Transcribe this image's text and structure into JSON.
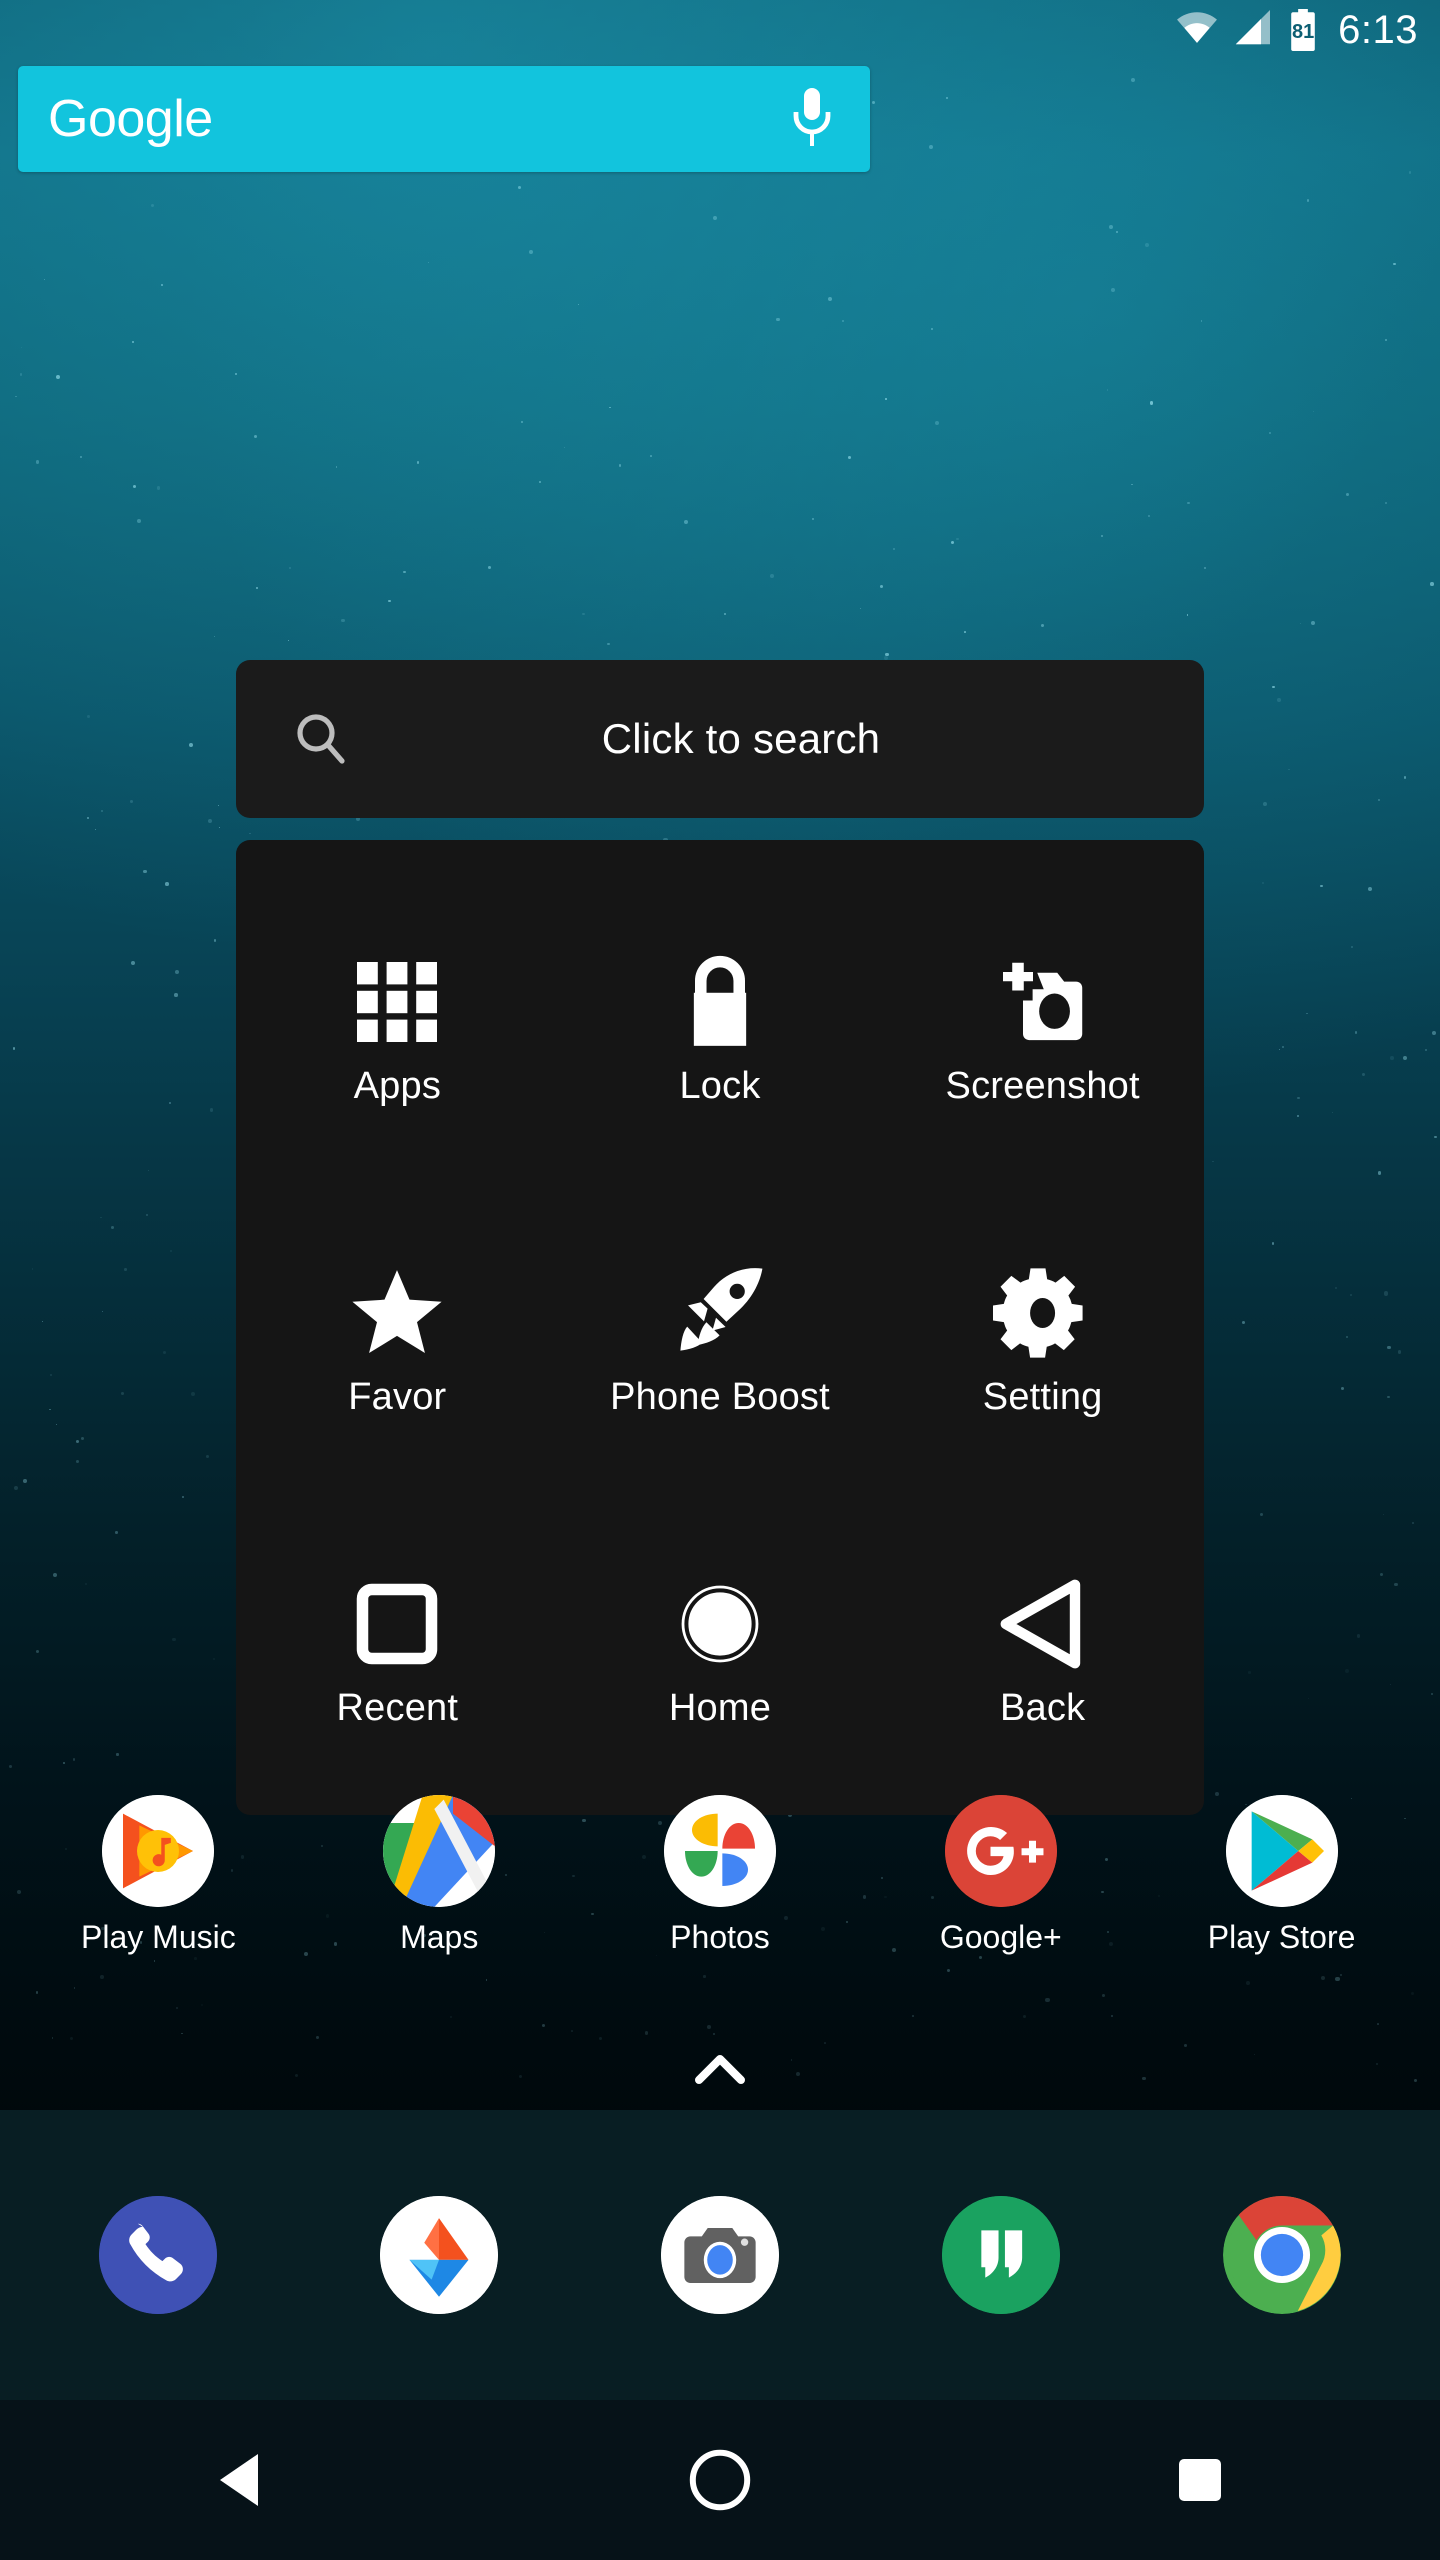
{
  "status_bar": {
    "wifi_icon": "wifi-icon",
    "signal_icon": "cellular-signal-icon",
    "battery_icon": "battery-icon",
    "battery_level": "81",
    "time": "6:13"
  },
  "search_widget": {
    "brand": "Google",
    "mic_icon": "microphone-icon",
    "background_color": "#12c4dd"
  },
  "overlay": {
    "search": {
      "icon": "magnifier-icon",
      "hint": "Click to search"
    },
    "tiles": [
      {
        "label": "Apps",
        "icon": "apps-grid-icon"
      },
      {
        "label": "Lock",
        "icon": "padlock-icon"
      },
      {
        "label": "Screenshot",
        "icon": "camera-plus-icon"
      },
      {
        "label": "Favor",
        "icon": "star-icon"
      },
      {
        "label": "Phone Boost",
        "icon": "rocket-icon"
      },
      {
        "label": "Setting",
        "icon": "gear-icon"
      },
      {
        "label": "Recent",
        "icon": "square-outline-icon"
      },
      {
        "label": "Home",
        "icon": "circle-outline-icon"
      },
      {
        "label": "Back",
        "icon": "triangle-left-outline-icon"
      }
    ]
  },
  "home_apps": [
    {
      "label": "Play Music",
      "icon": "play-music-icon"
    },
    {
      "label": "Maps",
      "icon": "google-maps-icon"
    },
    {
      "label": "Photos",
      "icon": "google-photos-icon"
    },
    {
      "label": "Google+",
      "icon": "google-plus-icon"
    },
    {
      "label": "Play Store",
      "icon": "play-store-icon"
    }
  ],
  "drawer_handle": {
    "icon": "chevron-up-icon"
  },
  "dock": [
    {
      "name": "Phone",
      "icon": "phone-icon"
    },
    {
      "name": "Drive",
      "icon": "google-drive-icon"
    },
    {
      "name": "Camera",
      "icon": "camera-icon"
    },
    {
      "name": "Hangouts",
      "icon": "hangouts-icon"
    },
    {
      "name": "Chrome",
      "icon": "chrome-icon"
    }
  ],
  "nav_bar": [
    {
      "name": "Back",
      "icon": "back-triangle-icon"
    },
    {
      "name": "Home",
      "icon": "home-circle-icon"
    },
    {
      "name": "Recents",
      "icon": "recents-square-icon"
    }
  ]
}
